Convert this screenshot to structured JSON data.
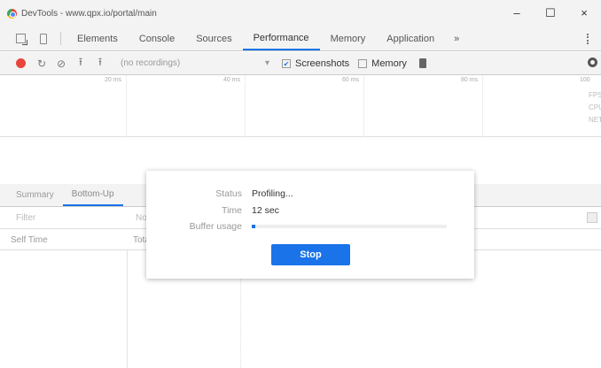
{
  "window": {
    "title": "DevTools - www.qpx.io/portal/main",
    "minimize": "–",
    "maximize": "☐",
    "close": "×"
  },
  "tabs": [
    {
      "label": "Elements",
      "active": false
    },
    {
      "label": "Console",
      "active": false
    },
    {
      "label": "Sources",
      "active": false
    },
    {
      "label": "Performance",
      "active": true
    },
    {
      "label": "Memory",
      "active": false
    },
    {
      "label": "Application",
      "active": false
    }
  ],
  "more_tabs": "»",
  "toolbar": {
    "recording_select": "(no recordings)",
    "screenshots_label": "Screenshots",
    "screenshots_checked": true,
    "memory_label": "Memory",
    "memory_checked": false
  },
  "ruler": [
    "20 ms",
    "40 ms",
    "60 ms",
    "80 ms",
    "100"
  ],
  "side_labels": [
    "FPS",
    "CPU",
    "NET"
  ],
  "bottom": {
    "tabs": [
      "Summary",
      "Bottom-Up"
    ],
    "filter_placeholder": "Filter",
    "grouping": "No Grouping",
    "columns": [
      "Self Time",
      "Total Time"
    ]
  },
  "modal": {
    "status_label": "Status",
    "status_value": "Profiling...",
    "time_label": "Time",
    "time_value": "12 sec",
    "buffer_label": "Buffer usage",
    "buffer_fraction": 0.02,
    "stop_label": "Stop"
  },
  "colors": {
    "accent": "#1a73e8",
    "record": "#e8453c"
  }
}
